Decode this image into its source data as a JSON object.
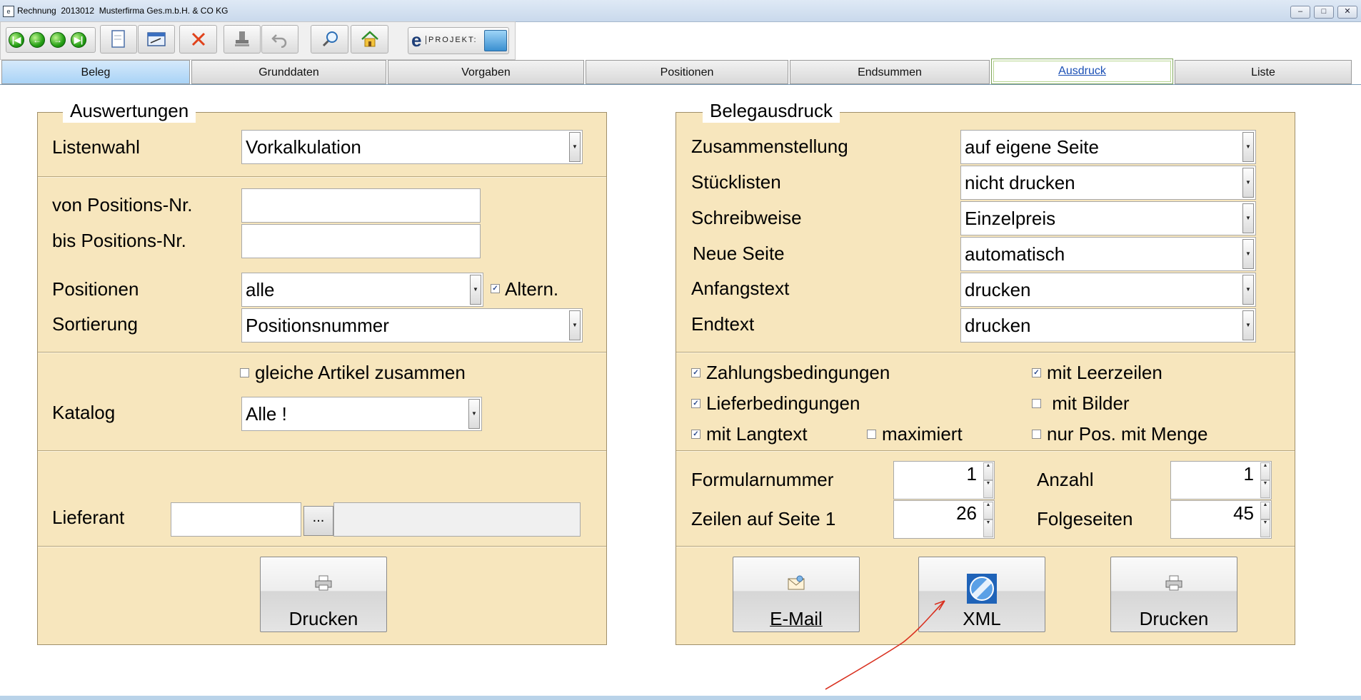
{
  "window": {
    "title": "Rechnung  2013012  Musterfirma Ges.m.b.H. & CO KG",
    "icon_name": "app-icon"
  },
  "toolbar": {
    "logo_text": "PROJEKT:",
    "logo_letter": "e",
    "buttons": [
      "first-record",
      "previous-record",
      "next-record",
      "last-record",
      "new-document",
      "edit",
      "delete",
      "stamp",
      "undo",
      "search",
      "home"
    ]
  },
  "tabs": [
    {
      "label": "Beleg"
    },
    {
      "label": "Grunddaten"
    },
    {
      "label": "Vorgaben"
    },
    {
      "label": "Positionen"
    },
    {
      "label": "Endsummen"
    },
    {
      "label": "Ausdruck",
      "active": true
    },
    {
      "label": "Liste"
    }
  ],
  "left": {
    "legend": "Auswertungen",
    "listenwahl_label": "Listenwahl",
    "listenwahl_value": "Vorkalkulation",
    "von_label": "von Positions-Nr.",
    "von_value": "",
    "bis_label": "bis Positions-Nr.",
    "bis_value": "",
    "positionen_label": "Positionen",
    "positionen_value": "alle",
    "altern_label": "Altern.",
    "altern_checked": true,
    "sortierung_label": "Sortierung",
    "sortierung_value": "Positionsnummer",
    "gleiche_label": "gleiche Artikel zusammen",
    "gleiche_checked": false,
    "katalog_label": "Katalog",
    "katalog_value": "Alle !",
    "lieferant_label": "Lieferant",
    "lieferant_value": "",
    "lieferant_browse": "...",
    "drucken_label": "Drucken"
  },
  "right": {
    "legend": "Belegausdruck",
    "rows": [
      {
        "label": "Zusammenstellung",
        "value": "auf eigene Seite"
      },
      {
        "label": "Stücklisten",
        "value": "nicht drucken"
      },
      {
        "label": "Schreibweise",
        "value": "Einzelpreis"
      },
      {
        "label": "Neue Seite",
        "value": "automatisch"
      },
      {
        "label": "Anfangstext",
        "value": "drucken"
      },
      {
        "label": "Endtext",
        "value": "drucken"
      }
    ],
    "checks": {
      "zahlung": {
        "label": "Zahlungsbedingungen",
        "checked": true
      },
      "liefer": {
        "label": "Lieferbedingungen",
        "checked": true
      },
      "langtext": {
        "label": "mit Langtext",
        "checked": true
      },
      "maximiert": {
        "label": "maximiert",
        "checked": false
      },
      "leerzeilen": {
        "label": "mit Leerzeilen",
        "checked": true
      },
      "bilder": {
        "label": " mit Bilder",
        "checked": false
      },
      "nurpos": {
        "label": "nur Pos. mit Menge",
        "checked": false
      }
    },
    "formularnummer_label": "Formularnummer",
    "formularnummer_value": "1",
    "anzahl_label": "Anzahl",
    "anzahl_value": "1",
    "zeilen_label": "Zeilen auf Seite 1",
    "zeilen_value": "26",
    "folgeseiten_label": "Folgeseiten",
    "folgeseiten_value": "45",
    "email_label": "E-Mail",
    "xml_label": "XML",
    "drucken_label": "Drucken"
  },
  "annotation": {
    "color": "#d9301f",
    "icon_name": "red-arrow-annotation"
  },
  "colors": {
    "panel": "#f7e6bd",
    "active_tab_text": "#1a4fb5"
  }
}
